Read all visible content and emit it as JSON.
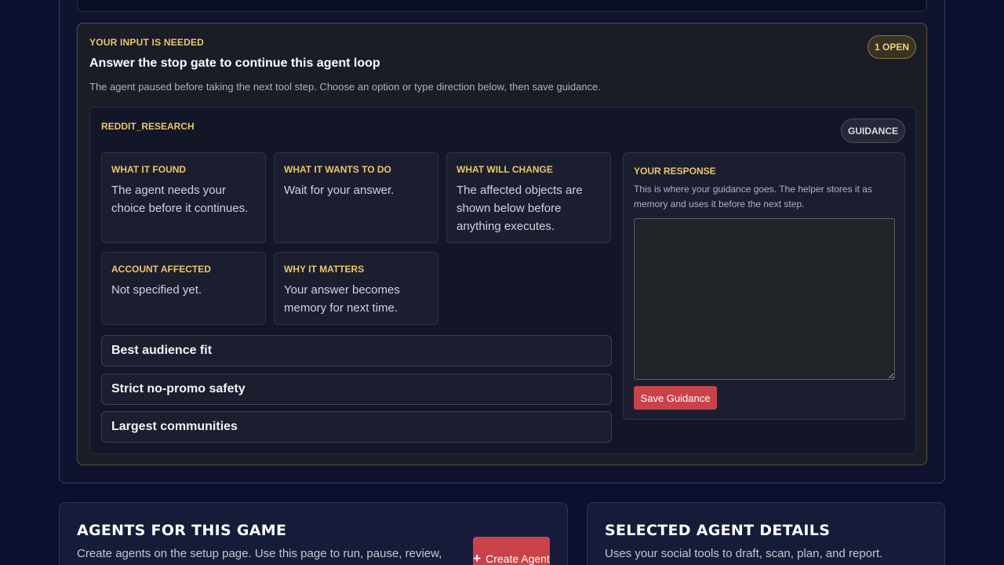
{
  "gate": {
    "eyebrow": "YOUR INPUT IS NEEDED",
    "title": "Answer the stop gate to continue this agent loop",
    "description": "The agent paused before taking the next tool step. Choose an option or type direction below, then save guidance.",
    "open_badge": "1 OPEN"
  },
  "tool": {
    "name": "REDDIT_RESEARCH",
    "badge": "GUIDANCE"
  },
  "info": {
    "found": {
      "label": "WHAT IT FOUND",
      "text": "The agent needs your choice before it continues."
    },
    "wants": {
      "label": "WHAT IT WANTS TO DO",
      "text": "Wait for your answer."
    },
    "change": {
      "label": "WHAT WILL CHANGE",
      "text": "The affected objects are shown below before anything executes."
    },
    "account": {
      "label": "ACCOUNT AFFECTED",
      "text": "Not specified yet."
    },
    "why": {
      "label": "WHY IT MATTERS",
      "text": "Your answer becomes memory for next time."
    }
  },
  "options": [
    "Best audience fit",
    "Strict no-promo safety",
    "Largest communities"
  ],
  "response": {
    "label": "YOUR RESPONSE",
    "help": "This is where your guidance goes. The helper stores it as memory and uses it before the next step.",
    "value": "",
    "save_label": "Save Guidance"
  },
  "agents_panel": {
    "title": "AGENTS FOR THIS GAME",
    "description": "Create agents on the setup page. Use this page to run, pause, review,",
    "create_label": "Create Agent"
  },
  "details_panel": {
    "title": "SELECTED AGENT DETAILS",
    "description": "Uses your social tools to draft, scan, plan, and report."
  },
  "colors": {
    "accent_gold": "#e8c66a",
    "primary_red": "#c9424a",
    "background": "#0b1030"
  },
  "icons": {
    "create": "plus-icon"
  }
}
